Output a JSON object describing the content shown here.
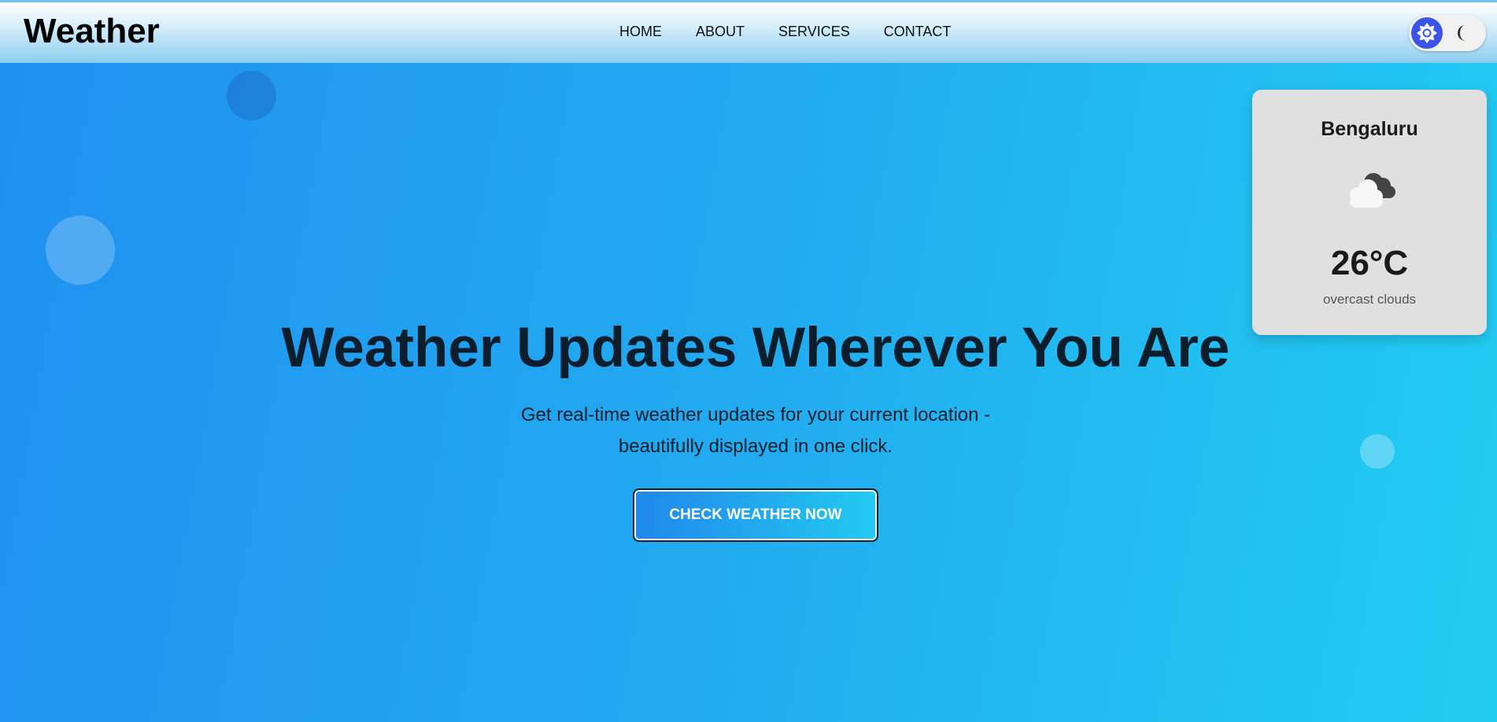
{
  "brand": "Weather",
  "nav": {
    "links": [
      "HOME",
      "ABOUT",
      "SERVICES",
      "CONTACT"
    ]
  },
  "theme_toggle": {
    "active_icon": "sun-icon",
    "inactive_icon": "moon-icon",
    "accent": "#3a54ea"
  },
  "hero": {
    "title": "Weather Updates Wherever You Are",
    "subtitle_line1": "Get real-time weather updates for your current location -",
    "subtitle_line2": "beautifully displayed in one click.",
    "cta_label": "CHECK WEATHER NOW"
  },
  "weather_card": {
    "city": "Bengaluru",
    "icon": "overcast-clouds-icon",
    "temperature": "26°C",
    "description": "overcast clouds"
  },
  "colors": {
    "background_start": "#2090f0",
    "background_end": "#22cdf2",
    "card_bg": "#e0e0e0"
  }
}
